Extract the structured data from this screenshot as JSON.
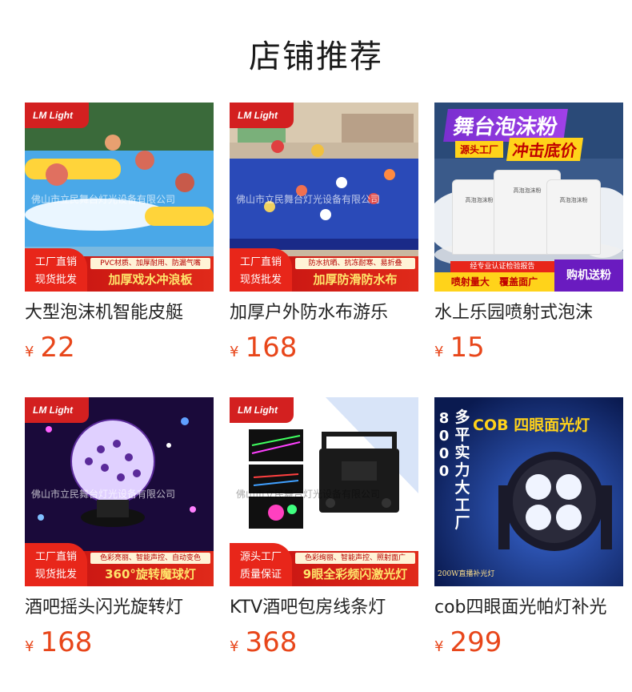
{
  "section": {
    "title": "店铺推荐"
  },
  "products": [
    {
      "name": "大型泡沫机智能皮艇",
      "currency": "¥",
      "price": "22",
      "image": {
        "brand": "LM Light",
        "watermark": "佛山市立民舞台灯光设备有限公司",
        "tag_line1": "工厂直销",
        "tag_line2": "现货批发",
        "sub_text": "PVC材质、加厚耐用、防漏气嘴",
        "main_text": "加厚戏水冲浪板"
      }
    },
    {
      "name": "加厚户外防水布游乐",
      "currency": "¥",
      "price": "168",
      "image": {
        "brand": "LM Light",
        "watermark": "佛山市立民舞台灯光设备有限公司",
        "tag_line1": "工厂直销",
        "tag_line2": "现货批发",
        "sub_text": "防水抗晒、抗冻耐寒、易折叠",
        "main_text": "加厚防滑防水布"
      }
    },
    {
      "name": "水上乐园喷射式泡沫",
      "currency": "¥",
      "price": "15",
      "image": {
        "title": "舞台泡沫粉",
        "sub1": "源头工厂",
        "sub2": "冲击底价",
        "bag_label": "高泡泡沫粉",
        "strip1": "经专业认证检验报告",
        "strip2": "喷射量大 覆盖面广",
        "buy": "购机送粉"
      }
    },
    {
      "name": "酒吧摇头闪光旋转灯",
      "currency": "¥",
      "price": "168",
      "image": {
        "brand": "LM Light",
        "watermark": "佛山市立民舞台灯光设备有限公司",
        "tag_line1": "工厂直销",
        "tag_line2": "现货批发",
        "sub_text": "色彩亮丽、智能声控、自动变色",
        "main_text": "360°旋转魔球灯"
      }
    },
    {
      "name": "KTV酒吧包房线条灯",
      "currency": "¥",
      "price": "368",
      "image": {
        "brand": "LM Light",
        "watermark": "佛山市立民舞台灯光设备有限公司",
        "tag_line1": "源头工厂",
        "tag_line2": "质量保证",
        "sub_text": "色彩绚丽、智能声控、照射面广",
        "main_text": "9眼全彩频闪激光灯"
      }
    },
    {
      "name": "cob四眼面光帕灯补光",
      "currency": "¥",
      "price": "299",
      "image": {
        "title": "COB 四眼面光灯",
        "vertical_text": "多平实力大工厂",
        "vertical_number": "8000",
        "footer": "200W直播补光灯"
      }
    }
  ],
  "colors": {
    "price": "#e8461a",
    "banner_red": "#d32020",
    "accent_yellow": "#ffd31a"
  }
}
